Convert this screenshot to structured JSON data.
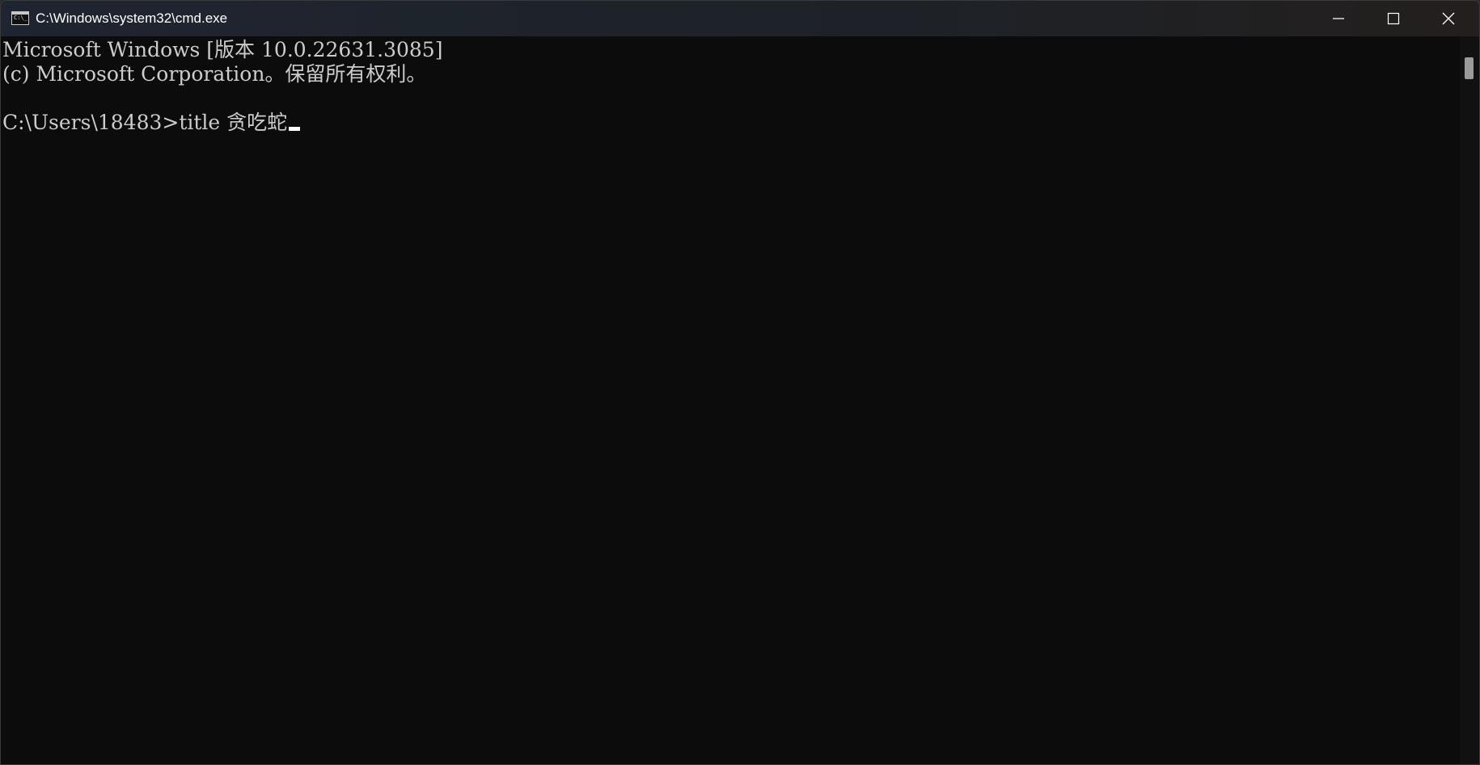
{
  "window": {
    "title": "C:\\Windows\\system32\\cmd.exe",
    "icon_text": "C:\\_"
  },
  "controls": {
    "minimize_icon": "minimize-icon",
    "maximize_icon": "maximize-icon",
    "close_icon": "close-icon"
  },
  "console": {
    "lines": [
      "Microsoft Windows [版本 10.0.22631.3085]",
      "(c) Microsoft Corporation。保留所有权利。",
      "C:\\Users\\18483>title 贪吃蛇"
    ]
  },
  "colors": {
    "background": "#0c0c0c",
    "text": "#cccccc",
    "titlebar": "#1f2530"
  }
}
